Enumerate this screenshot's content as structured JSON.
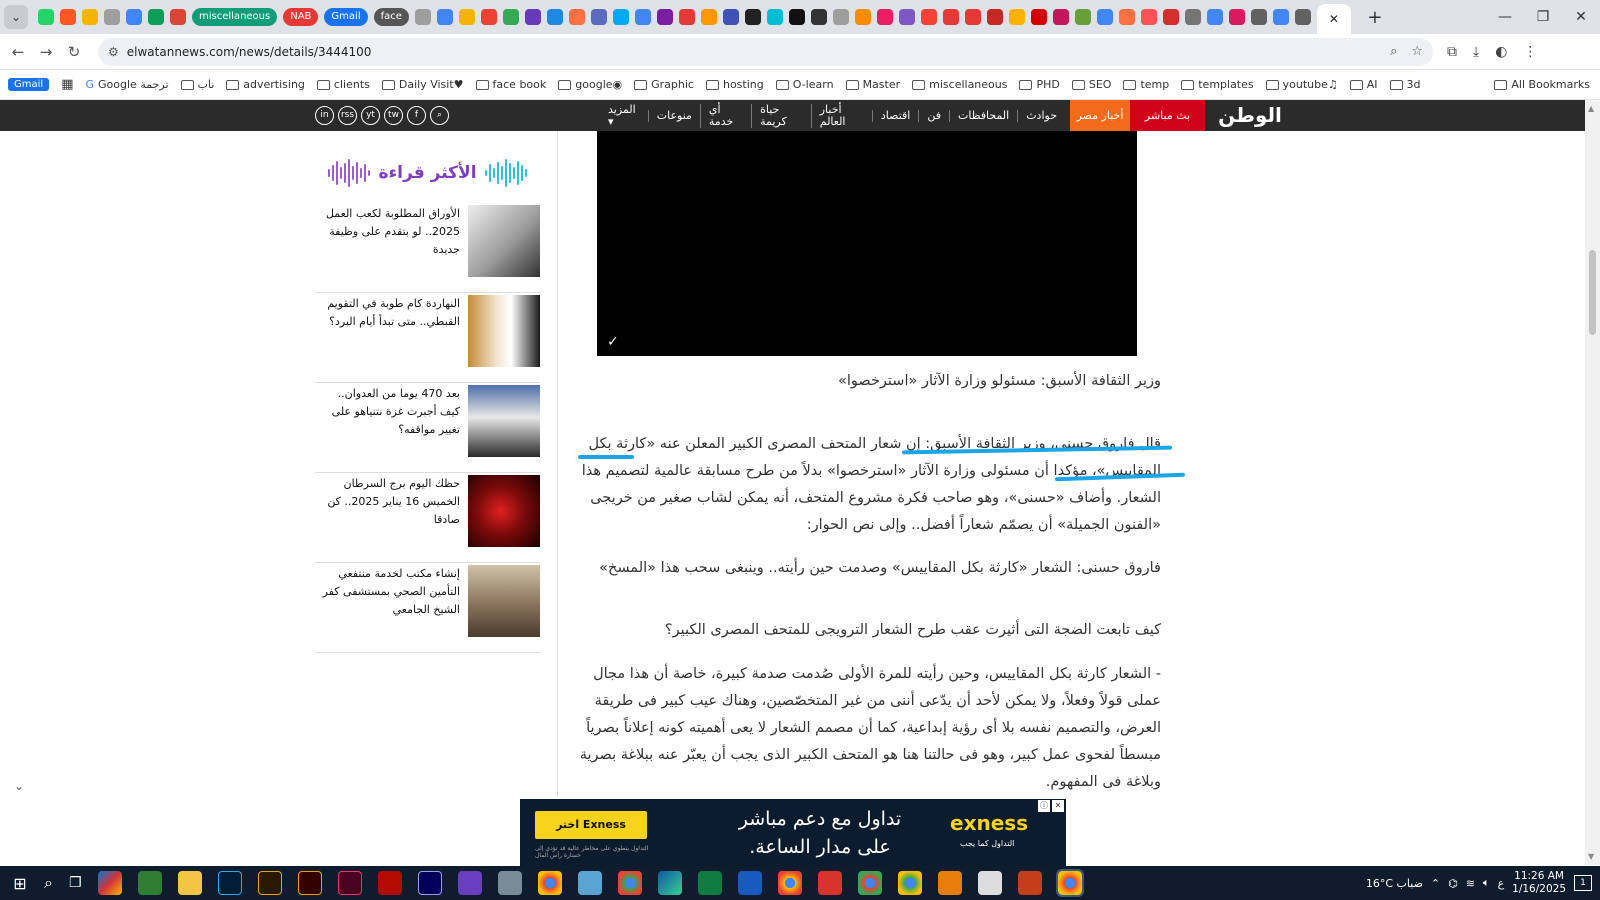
{
  "browser": {
    "labeled_tabs": [
      {
        "label": "miscellaneous",
        "color": "#139c78"
      },
      {
        "label": "NAB",
        "color": "#e53935"
      },
      {
        "label": "Gmail",
        "color": "#1a73e8"
      },
      {
        "label": "face",
        "color": "#555555"
      }
    ],
    "active_tab_close": "✕",
    "new_tab": "+",
    "window_controls": [
      "—",
      "❐",
      "✕"
    ],
    "url": "elwatannews.com/news/details/3444100",
    "bookmarks": [
      {
        "label": "Gmail",
        "type": "badge"
      },
      {
        "label": "Google ترجمة",
        "type": "link"
      },
      {
        "label": "ناب",
        "type": "folder"
      },
      {
        "label": "advertising",
        "type": "folder"
      },
      {
        "label": "clients",
        "type": "folder"
      },
      {
        "label": "Daily Visit♥",
        "type": "folder"
      },
      {
        "label": "face book",
        "type": "folder"
      },
      {
        "label": "google◉",
        "type": "folder"
      },
      {
        "label": "Graphic",
        "type": "folder"
      },
      {
        "label": "hosting",
        "type": "folder"
      },
      {
        "label": "O-learn",
        "type": "folder"
      },
      {
        "label": "Master",
        "type": "folder"
      },
      {
        "label": "miscellaneous",
        "type": "folder"
      },
      {
        "label": "PHD",
        "type": "folder"
      },
      {
        "label": "SEO",
        "type": "folder"
      },
      {
        "label": "temp",
        "type": "folder"
      },
      {
        "label": "templates",
        "type": "folder"
      },
      {
        "label": "youtube♫",
        "type": "folder"
      },
      {
        "label": "AI",
        "type": "folder"
      },
      {
        "label": "3d",
        "type": "folder"
      }
    ],
    "all_bookmarks": "All Bookmarks"
  },
  "site": {
    "logo": "الوطن",
    "live": "بث مباشر",
    "egypt_news": "أخبار مصر",
    "menu": [
      "حوادث",
      "المحافظات",
      "فن",
      "اقتصاد",
      "أخبار العالم",
      "حياة كريمة",
      "أي خدمة",
      "منوعات",
      "المزيد ▾"
    ],
    "social": [
      "in",
      "rss",
      "yt",
      "tw",
      "f",
      "⌕"
    ]
  },
  "sidebar": {
    "title": "الأكثر قراءة",
    "items": [
      {
        "text": "الأوراق المطلوبة لكعب العمل 2025.. لو بتقدم على وظيفة جديدة",
        "thumb_color": "#7a7a7a"
      },
      {
        "text": "النهاردة كام طوبة في التقويم القبطي.. متى تبدأ أيام البرد؟",
        "thumb_color": "#c58a3a"
      },
      {
        "text": "بعد 470 يوما من العدوان.. كيف أجبرت غزة نتنياهو على تغيير مواقفه؟",
        "thumb_color": "#3b5a86"
      },
      {
        "text": "حظك اليوم برج السرطان الخميس 16 يناير 2025.. كن صادقا",
        "thumb_color": "#8b0d0d"
      },
      {
        "text": "إنشاء مكتب لخدمة منتفعي التأمين الصحي بمستشفى كفر الشيخ الجامعي",
        "thumb_color": "#8f7a62"
      }
    ]
  },
  "article": {
    "video_check": "✓",
    "heading1": "وزير الثقافة الأسبق: مسئولو وزارة الآثار «استرخصوا»",
    "para1": "قال فاروق حسنى، وزير الثقافة الأسبق: إن شعار المتحف المصرى الكبير المعلن عنه «كارثة بكل المقاييس»، مؤكدا أن مسئولى وزارة الآثار «استرخصوا» بدلاً من طرح مسابقة عالمية لتصميم هذا الشعار. وأضاف «حسنى»، وهو صاحب فكرة مشروع المتحف، أنه يمكن لشاب صغير من خريجى «الفنون الجميلة» أن يصمّم شعاراً أفضل.. وإلى نص الحوار:",
    "para2": "فاروق حسنى: الشعار «كارثة بكل المقاييس» وصدمت حين رأيته.. وينبغى سحب هذا «المسخ»",
    "heading2": "كيف تابعت الضجة التى أثيرت عقب طرح الشعار الترويجى للمتحف المصرى الكبير؟",
    "para3": "- الشعار كارثة بكل المقاييس، وحين رأيته للمرة الأولى صُدمت صدمة كبيرة، خاصة أن هذا مجال عملى قولاً وفعلاً، ولا يمكن لأحد أن يدّعى أننى من غير المتخصّصين، وهناك عيب كبير فى طريقة العرض، والتصميم نفسه بلا أى رؤية إبداعية، كما أن مصمم الشعار لا يعى أهميته كونه إعلاناً بصرياً مبسطاً لفحوى عمل كبير، وهو فى حالتنا هنا هو المتحف الكبير الذى يجب أن يعبّر عنه ببلاغة بصرية وبلاغة فى المفهوم."
  },
  "ad": {
    "button": "اختر Exness",
    "headline": "تداول مع دعم مباشر على مدار الساعة.",
    "brand": "exness",
    "brand_sub": "التداول كما يجب",
    "small_print": "التداول ينطوي على مخاطر عالية قد تؤدي إلى خسارة رأس المال",
    "close": [
      "ⓘ",
      "✕"
    ]
  },
  "taskbar": {
    "weather": "16°C ضباب",
    "lang": "ع",
    "time": "11:26 AM",
    "date": "1/16/2025",
    "notification_count": "1"
  },
  "colors": {
    "site_nav": "#2b2b2b",
    "live_red": "#d0021b",
    "egypt_orange": "#f26b1d",
    "annotation_blue": "#1ca6e8",
    "most_read_purple": "#7d3fbd"
  }
}
